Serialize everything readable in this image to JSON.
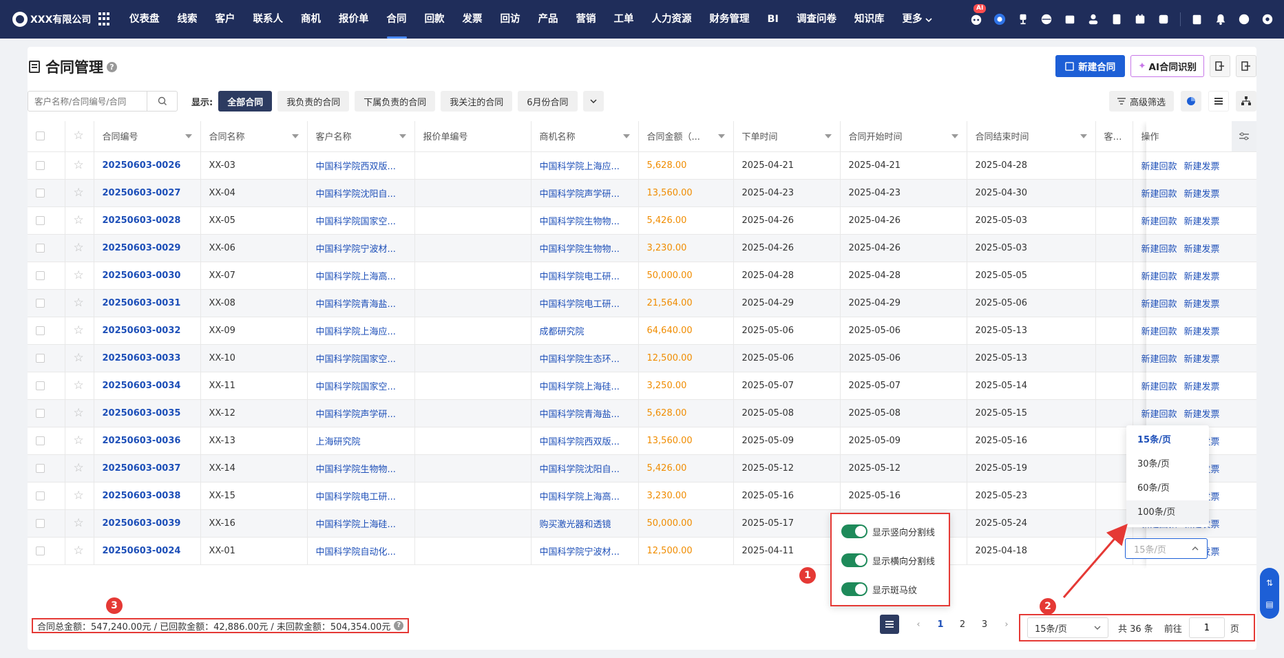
{
  "app": {
    "company": "XXX有限公司",
    "ai_badge": "AI"
  },
  "nav": {
    "items": [
      "仪表盘",
      "线索",
      "客户",
      "联系人",
      "商机",
      "报价单",
      "合同",
      "回款",
      "发票",
      "回访",
      "产品",
      "营销",
      "工单",
      "人力资源",
      "财务管理",
      "BI",
      "调查问卷",
      "知识库",
      "更多"
    ],
    "active": "合同"
  },
  "page": {
    "title": "合同管理",
    "help": "?",
    "new_contract": "新建合同",
    "ai_recognize": "AI合同识别"
  },
  "filters": {
    "search_placeholder": "客户名称/合同编号/合同",
    "show_label": "显示:",
    "chips": [
      "全部合同",
      "我负责的合同",
      "下属负责的合同",
      "我关注的合同",
      "6月份合同"
    ],
    "active_chip": "全部合同",
    "advanced": "高级筛选"
  },
  "table": {
    "columns": [
      "合同编号",
      "合同名称",
      "客户名称",
      "报价单编号",
      "商机名称",
      "合同金额（...",
      "下单时间",
      "合同开始时间",
      "合同结束时间",
      "客户签",
      "操作"
    ],
    "op_labels": [
      "新建回款",
      "新建发票"
    ],
    "rows": [
      {
        "code": "20250603-0026",
        "name": "XX-03",
        "customer": "中国科学院西双版...",
        "opp": "中国科学院上海应...",
        "amount": "5,628.00",
        "order": "2025-04-21",
        "start": "2025-04-21",
        "end": "2025-04-28"
      },
      {
        "code": "20250603-0027",
        "name": "XX-04",
        "customer": "中国科学院沈阳自...",
        "opp": "中国科学院声学研...",
        "amount": "13,560.00",
        "order": "2025-04-23",
        "start": "2025-04-23",
        "end": "2025-04-30"
      },
      {
        "code": "20250603-0028",
        "name": "XX-05",
        "customer": "中国科学院国家空...",
        "opp": "中国科学院生物物...",
        "amount": "5,426.00",
        "order": "2025-04-26",
        "start": "2025-04-26",
        "end": "2025-05-03"
      },
      {
        "code": "20250603-0029",
        "name": "XX-06",
        "customer": "中国科学院宁波材...",
        "opp": "中国科学院生物物...",
        "amount": "3,230.00",
        "order": "2025-04-26",
        "start": "2025-04-26",
        "end": "2025-05-03"
      },
      {
        "code": "20250603-0030",
        "name": "XX-07",
        "customer": "中国科学院上海高...",
        "opp": "中国科学院电工研...",
        "amount": "50,000.00",
        "order": "2025-04-28",
        "start": "2025-04-28",
        "end": "2025-05-05"
      },
      {
        "code": "20250603-0031",
        "name": "XX-08",
        "customer": "中国科学院青海盐...",
        "opp": "中国科学院电工研...",
        "amount": "21,564.00",
        "order": "2025-04-29",
        "start": "2025-04-29",
        "end": "2025-05-06"
      },
      {
        "code": "20250603-0032",
        "name": "XX-09",
        "customer": "中国科学院上海应...",
        "opp": "成都研究院",
        "amount": "64,640.00",
        "order": "2025-05-06",
        "start": "2025-05-06",
        "end": "2025-05-13"
      },
      {
        "code": "20250603-0033",
        "name": "XX-10",
        "customer": "中国科学院国家空...",
        "opp": "中国科学院生态环...",
        "amount": "12,500.00",
        "order": "2025-05-06",
        "start": "2025-05-06",
        "end": "2025-05-13"
      },
      {
        "code": "20250603-0034",
        "name": "XX-11",
        "customer": "中国科学院国家空...",
        "opp": "中国科学院上海硅...",
        "amount": "3,250.00",
        "order": "2025-05-07",
        "start": "2025-05-07",
        "end": "2025-05-14"
      },
      {
        "code": "20250603-0035",
        "name": "XX-12",
        "customer": "中国科学院声学研...",
        "opp": "中国科学院青海盐...",
        "amount": "5,628.00",
        "order": "2025-05-08",
        "start": "2025-05-08",
        "end": "2025-05-15"
      },
      {
        "code": "20250603-0036",
        "name": "XX-13",
        "customer": "上海研究院",
        "opp": "中国科学院西双版...",
        "amount": "13,560.00",
        "order": "2025-05-09",
        "start": "2025-05-09",
        "end": "2025-05-16"
      },
      {
        "code": "20250603-0037",
        "name": "XX-14",
        "customer": "中国科学院生物物...",
        "opp": "中国科学院沈阳自...",
        "amount": "5,426.00",
        "order": "2025-05-12",
        "start": "2025-05-12",
        "end": "2025-05-19"
      },
      {
        "code": "20250603-0038",
        "name": "XX-15",
        "customer": "中国科学院电工研...",
        "opp": "中国科学院上海高...",
        "amount": "3,230.00",
        "order": "2025-05-16",
        "start": "2025-05-16",
        "end": "2025-05-23"
      },
      {
        "code": "20250603-0039",
        "name": "XX-16",
        "customer": "中国科学院上海硅...",
        "opp": "购买激光器和透镜",
        "amount": "50,000.00",
        "order": "2025-05-17",
        "start": "",
        "end": "2025-05-24"
      },
      {
        "code": "20250603-0024",
        "name": "XX-01",
        "customer": "中国科学院自动化...",
        "opp": "中国科学院宁波材...",
        "amount": "12,500.00",
        "order": "2025-04-11",
        "start": "",
        "end": "2025-04-18"
      }
    ]
  },
  "summary": {
    "text": "合同总金额：547,240.00元 / 已回款金额：42,886.00元 / 未回款金额：504,354.00元"
  },
  "toggles": [
    "显示竖向分割线",
    "显示横向分割线",
    "显示斑马纹"
  ],
  "pagination": {
    "pages": [
      "1",
      "2",
      "3"
    ],
    "current": "1",
    "page_size": "15条/页",
    "total": "共 36 条",
    "goto_label": "前往",
    "goto_value": "1",
    "page_unit": "页",
    "size_options": [
      "15条/页",
      "30条/页",
      "60条/页",
      "100条/页"
    ],
    "size_placeholder": "15条/页"
  },
  "badges": [
    "1",
    "2",
    "3"
  ],
  "colors": {
    "accent": "#1d5fd6",
    "nav_bg": "#1f2d5a",
    "amount": "#f08c00",
    "highlight": "#e53935",
    "toggle_on": "#1e8a5a"
  }
}
